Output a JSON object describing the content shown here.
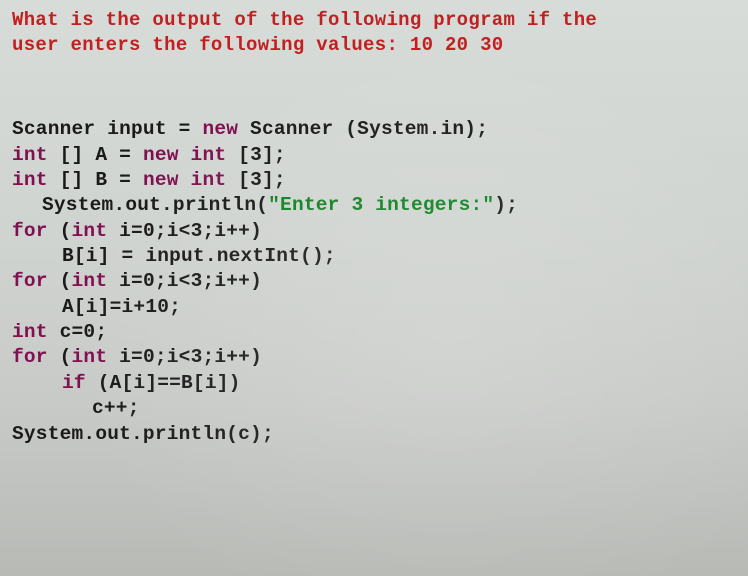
{
  "question": {
    "line1": "What is the output of the following program if the",
    "line2": "user enters the following values: 10 20 30"
  },
  "code": {
    "l1_a": "Scanner input = ",
    "l1_kw": "new",
    "l1_b": " Scanner (System.in);",
    "l2_kw1": "int",
    "l2_a": " [] A = ",
    "l2_kw2": "new int",
    "l2_b": " [3];",
    "l3_kw1": "int",
    "l3_a": " [] B = ",
    "l3_kw2": "new int",
    "l3_b": " [3];",
    "l4_a": "System.out.println(",
    "l4_str": "\"Enter 3 integers:\"",
    "l4_b": ");",
    "l5_kw": "for",
    "l5_a": " (",
    "l5_kw2": "int",
    "l5_b": " i=0;i<3;i++)",
    "l6": "B[i] = input.nextInt();",
    "l7_kw": "for",
    "l7_a": " (",
    "l7_kw2": "int",
    "l7_b": " i=0;i<3;i++)",
    "l8": "A[i]=i+10;",
    "l9_kw": "int",
    "l9_a": " c=0;",
    "l10_kw": "for",
    "l10_a": " (",
    "l10_kw2": "int",
    "l10_b": " i=0;i<3;i++)",
    "l11_kw": "if",
    "l11_a": " (A[i]==B[i])",
    "l12": "c++;",
    "l13": "System.out.println(c);"
  }
}
